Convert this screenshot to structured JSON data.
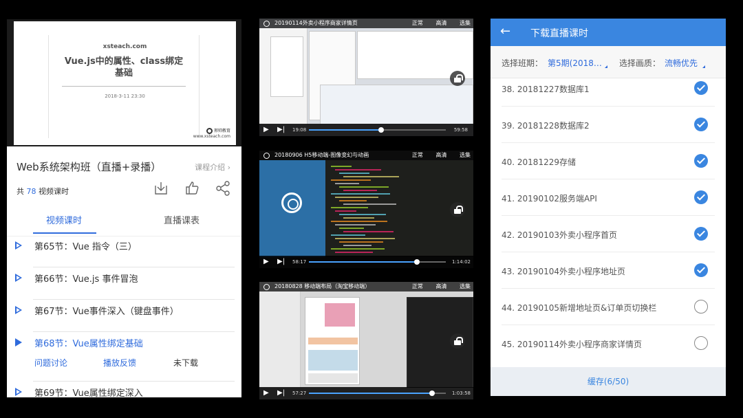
{
  "left": {
    "cover": {
      "brand": "xsteach.com",
      "title_line1": "Vue.js中的属性、class绑定",
      "title_line2": "基础",
      "date": "2018-3-11 23:30",
      "logo_text": "邢帅教育",
      "logo_sub": "www.xsteach.com"
    },
    "course_title": "Web系统架构班（直播+录播）",
    "intro_link": "课程介绍 ›",
    "count_prefix": "共",
    "count_value": "78",
    "count_suffix": "视频课时",
    "tabs": [
      "视频课时",
      "直播课表"
    ],
    "lessons": [
      {
        "name": "第65节：Vue 指令（三）"
      },
      {
        "name": "第66节：Vue.js 事件冒泡"
      },
      {
        "name": "第67节：Vue事件深入（键盘事件）"
      },
      {
        "name": "第68节：Vue属性绑定基础",
        "actions": [
          "问题讨论",
          "播放反馈",
          "未下载"
        ]
      },
      {
        "name": "第69节：Vue属性绑定深入"
      }
    ],
    "icons": [
      "download-icon",
      "like-icon",
      "share-icon"
    ]
  },
  "videos": [
    {
      "title": "20190114外卖小程序商家详情页",
      "options": [
        "正常",
        "高清",
        "选集"
      ],
      "current": "19:08",
      "total": "59:58",
      "progress": 0.53
    },
    {
      "title": "20180906 H5移动端-图像变幻与动画",
      "options": [
        "正常",
        "高清",
        "选集"
      ],
      "current": "58:17",
      "total": "1:14:02",
      "progress": 0.79
    },
    {
      "title": "20180828 移动端布局（淘宝移动端）",
      "options": [
        "正常",
        "高清",
        "选集"
      ],
      "current": "57:27",
      "total": "1:03:58",
      "progress": 0.9
    }
  ],
  "right": {
    "title": "下载直播课时",
    "back_icon": "←",
    "class_label": "选择班期：",
    "class_value": "第5期(2018…",
    "quality_label": "选择画质：",
    "quality_value": "流畅优先",
    "items": [
      {
        "label": "38. 20181227数据库1",
        "checked": true
      },
      {
        "label": "39. 20181228数据库2",
        "checked": true
      },
      {
        "label": "40. 20181229存储",
        "checked": true
      },
      {
        "label": "41. 20190102服务端API",
        "checked": true
      },
      {
        "label": "42. 20190103外卖小程序首页",
        "checked": true
      },
      {
        "label": "43. 20190104外卖小程序地址页",
        "checked": true
      },
      {
        "label": "44. 20190105新增地址页&订单页切换栏",
        "checked": false
      },
      {
        "label": "45. 20190114外卖小程序商家详情页",
        "checked": false
      }
    ],
    "cache_button": "缓存(6/50)"
  },
  "colors": {
    "accent": "#3a86e0",
    "link": "#2f6bdc",
    "background": "#000000"
  }
}
